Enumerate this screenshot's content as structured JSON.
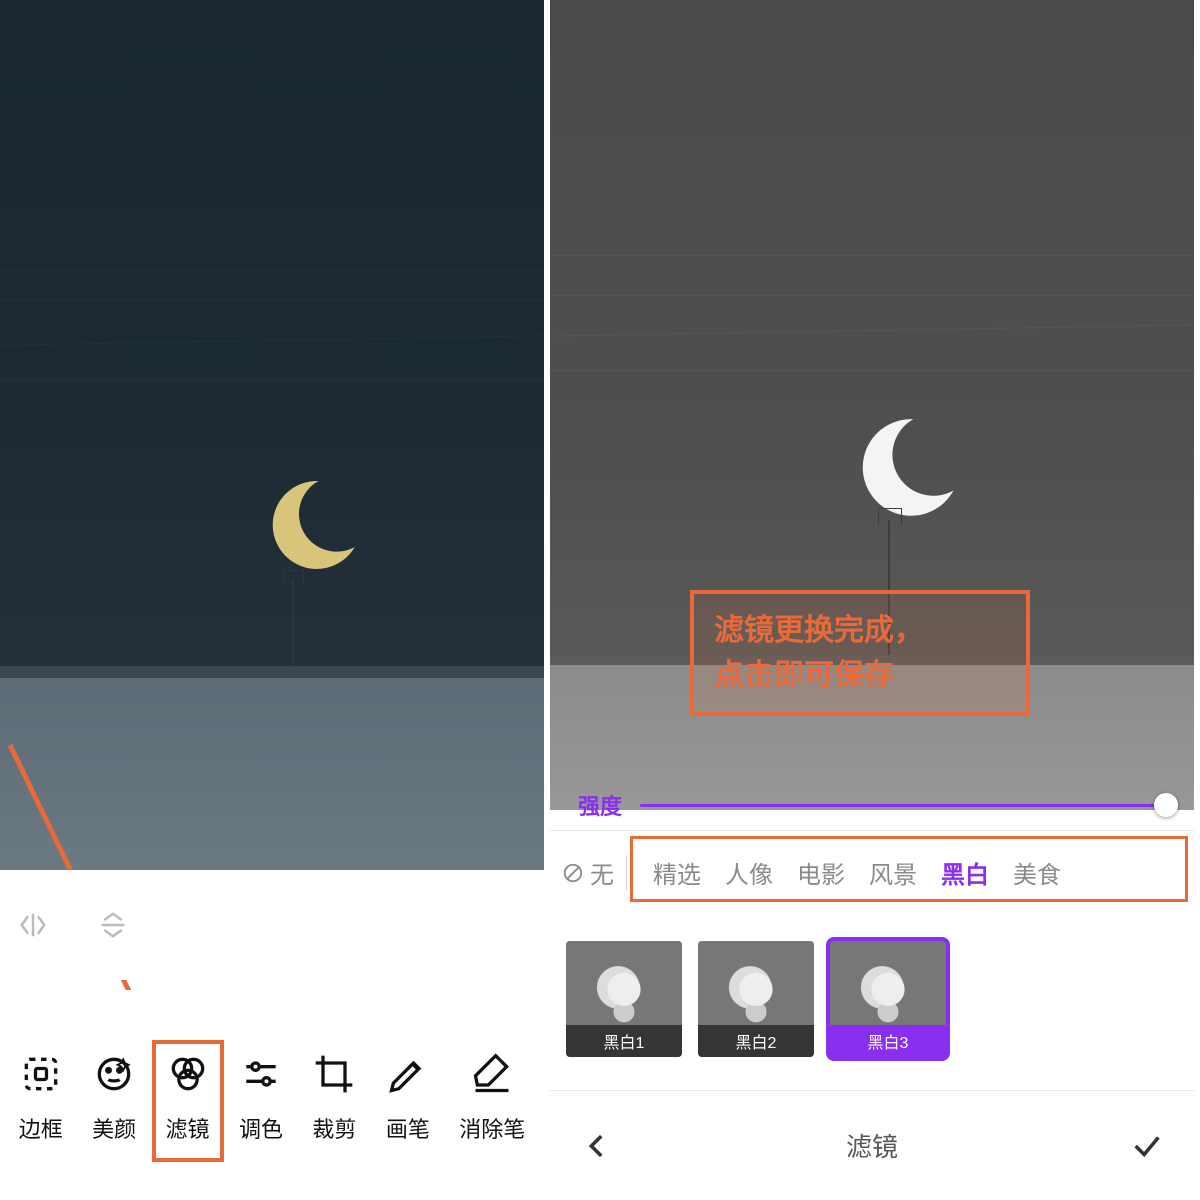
{
  "left": {
    "tools": [
      {
        "name": "frame",
        "label": "边框"
      },
      {
        "name": "beauty",
        "label": "美颜"
      },
      {
        "name": "filter",
        "label": "滤镜"
      },
      {
        "name": "adjust",
        "label": "调色"
      },
      {
        "name": "crop",
        "label": "裁剪"
      },
      {
        "name": "brush",
        "label": "画笔"
      },
      {
        "name": "eraser",
        "label": "消除笔"
      }
    ]
  },
  "right": {
    "callout_line1": "滤镜更换完成，",
    "callout_line2": "点击即可保存",
    "slider_label": "强度",
    "none_label": "无",
    "categories": [
      {
        "name": "featured",
        "label": "精选",
        "active": false
      },
      {
        "name": "portrait",
        "label": "人像",
        "active": false
      },
      {
        "name": "movie",
        "label": "电影",
        "active": false
      },
      {
        "name": "landscape",
        "label": "风景",
        "active": false
      },
      {
        "name": "bw",
        "label": "黑白",
        "active": true
      },
      {
        "name": "food",
        "label": "美食",
        "active": false
      }
    ],
    "thumbs": [
      {
        "name": "bw1",
        "label": "黑白1",
        "selected": false
      },
      {
        "name": "bw2",
        "label": "黑白2",
        "selected": false
      },
      {
        "name": "bw3",
        "label": "黑白3",
        "selected": true
      }
    ],
    "bottom_title": "滤镜"
  },
  "colors": {
    "accent": "#8a2ef0",
    "annotation": "#e86a3a"
  }
}
